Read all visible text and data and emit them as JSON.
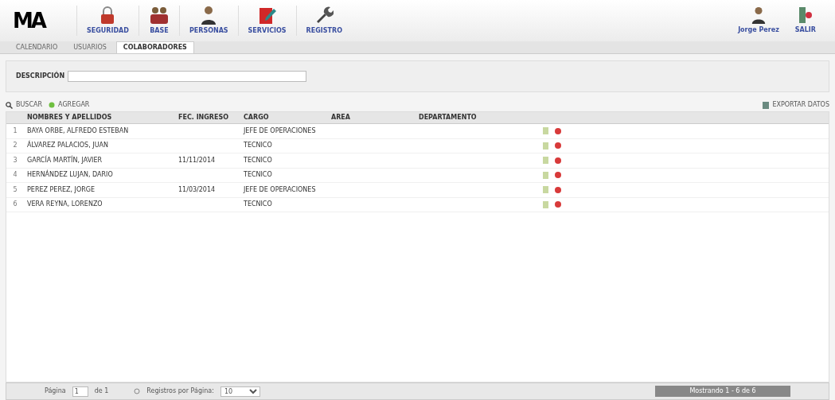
{
  "header": {
    "logo": "MA",
    "menu": [
      {
        "label": "SEGURIDAD",
        "kind": "lock"
      },
      {
        "label": "BASE",
        "kind": "group"
      },
      {
        "label": "PERSONAS",
        "kind": "person"
      },
      {
        "label": "SERVICIOS",
        "kind": "edit"
      },
      {
        "label": "REGISTRO",
        "kind": "tool"
      }
    ],
    "user": "Jorge Perez",
    "logout": "SALIR"
  },
  "tabs": [
    {
      "label": "CALENDARIO",
      "selected": false
    },
    {
      "label": "USUARIOS",
      "selected": false
    },
    {
      "label": "COLABORADORES",
      "selected": true
    }
  ],
  "filter": {
    "label": "DESCRIPCIÓN"
  },
  "toolbar": {
    "search": "BUSCAR",
    "add": "AGREGAR",
    "export": "EXPORTAR DATOS"
  },
  "table": {
    "columns": [
      "NOMBRES Y APELLIDOS",
      "FEC. INGRESO",
      "CARGO",
      "AREA",
      "DEPARTAMENTO"
    ],
    "rows": [
      {
        "index": "1",
        "name": "BAYA ORBE, ALFREDO ESTEBAN",
        "date": "",
        "role": "JEFE DE OPERACIONES"
      },
      {
        "index": "2",
        "name": "ÁLVAREZ PALACIOS, JUAN",
        "date": "",
        "role": "TECNICO"
      },
      {
        "index": "3",
        "name": "GARCÍA MARTÍN, JAVIER",
        "date": "11/11/2014",
        "role": "TECNICO"
      },
      {
        "index": "4",
        "name": "HERNÁNDEZ LUJAN, DARIO",
        "date": "",
        "role": "TECNICO"
      },
      {
        "index": "5",
        "name": "PEREZ PEREZ, JORGE",
        "date": "11/03/2014",
        "role": "JEFE DE OPERACIONES"
      },
      {
        "index": "6",
        "name": "VERA REYNA, LORENZO",
        "date": "",
        "role": "TECNICO"
      }
    ]
  },
  "pager": {
    "page_label": "Página",
    "page": "1",
    "of": "de 1",
    "per_page_label": "Registros por Página:",
    "per_page": "10",
    "summary": "Mostrando 1 - 6 de 6"
  }
}
